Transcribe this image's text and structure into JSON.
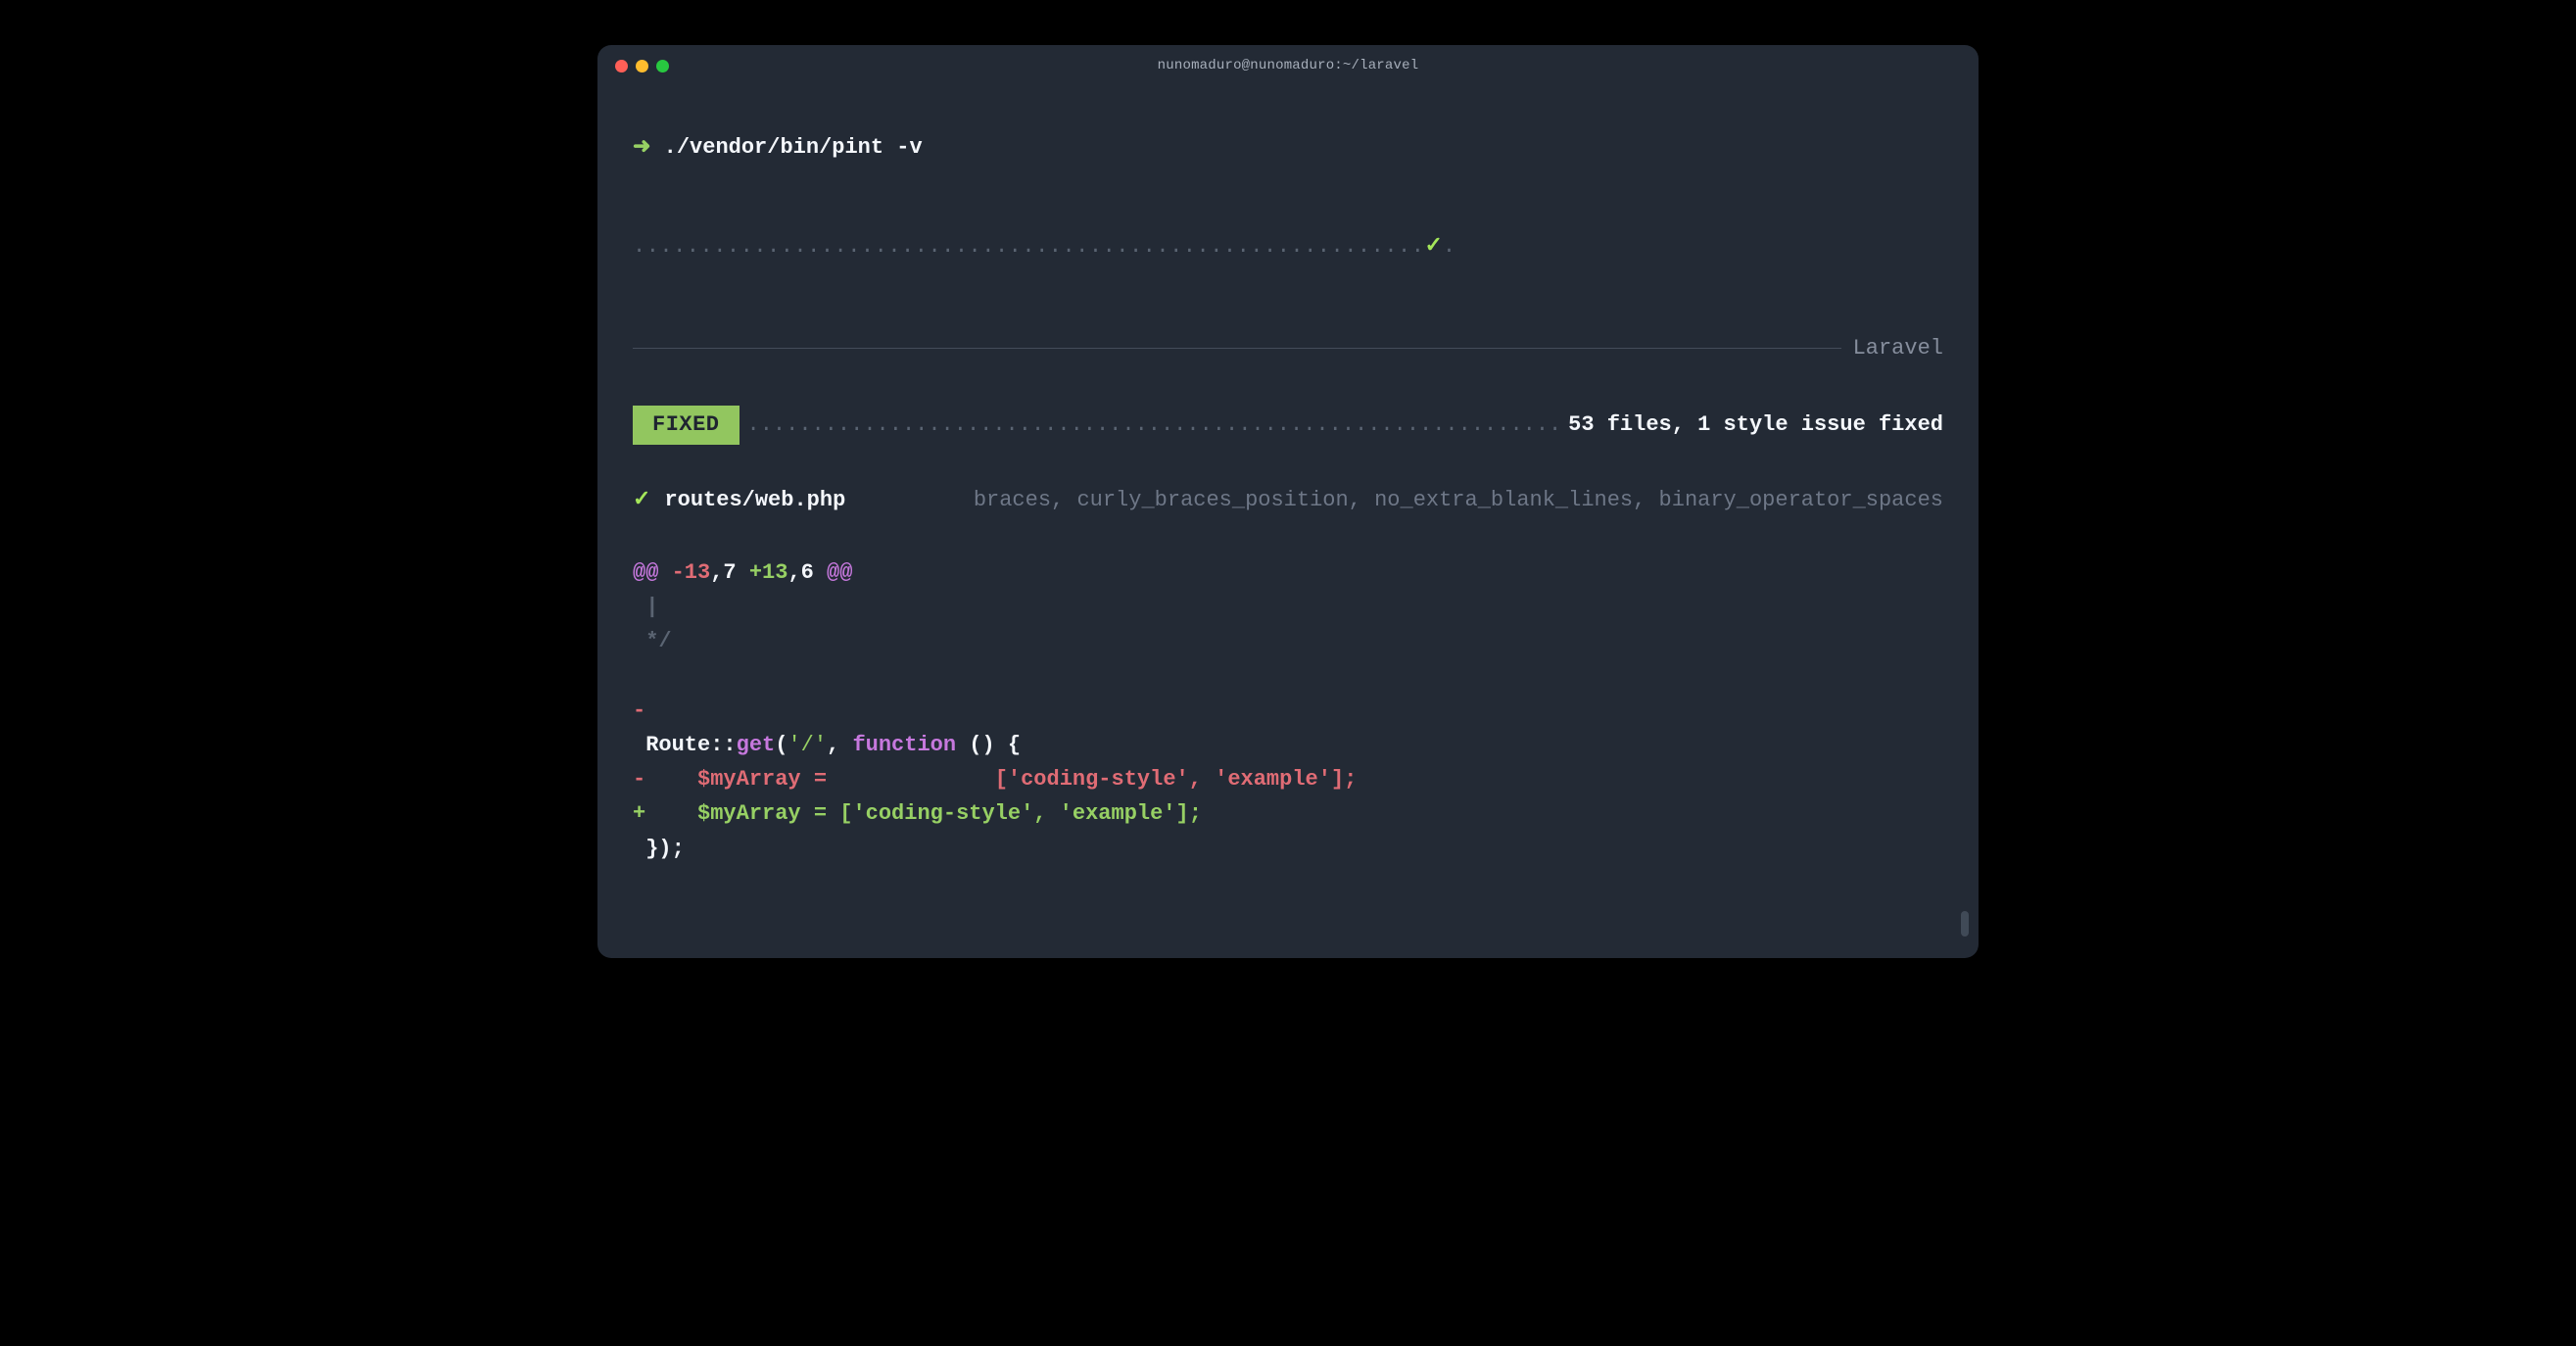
{
  "titlebar": {
    "text": "nunomaduro@nunomaduro:~/laravel"
  },
  "prompt": {
    "arrow": "➜",
    "command": "./vendor/bin/pint",
    "flag": "-v"
  },
  "progress": {
    "dots_before": "...........................................................",
    "check": "✓",
    "dots_after": "."
  },
  "ruler": {
    "label": "Laravel"
  },
  "status": {
    "pill": "FIXED",
    "fill": "...............................................................",
    "summary": "53 files, 1 style issue fixed"
  },
  "file": {
    "check": "✓",
    "name": "routes/web.php",
    "rules": "braces, curly_braces_position, no_extra_blank_lines, binary_operator_spaces"
  },
  "diff": {
    "hunk": {
      "at1": "@@ ",
      "minus": "-13",
      "c1": ",7 ",
      "plus": "+13",
      "c2": ",6 ",
      "at2": "@@"
    },
    "ctx1": " |",
    "ctx2": " */",
    "blank": "",
    "removed_blank": "-",
    "route_static": " Route",
    "dbl": "::",
    "get": "get",
    "lp": "(",
    "slash": "'/'",
    "comma": ", ",
    "func": "function ",
    "paren": "() {",
    "del_line": {
      "sign": "-",
      "lead": "    $myArray ",
      "eq": "=",
      "gap": "             ",
      "arr": "['coding-style', 'example'];"
    },
    "add_line": {
      "sign": "+",
      "lead": "    $myArray ",
      "eq": "=",
      "sp": " ",
      "arr": "['coding-style', 'example'];"
    },
    "close": " });"
  }
}
